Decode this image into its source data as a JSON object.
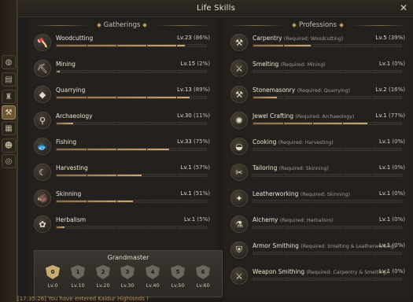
{
  "window": {
    "title": "Life Skills",
    "close_glyph": "✕"
  },
  "left_rail": {
    "icons": [
      {
        "name": "bag-icon",
        "glyph": "◍"
      },
      {
        "name": "book-icon",
        "glyph": "▤"
      },
      {
        "name": "trophy-icon",
        "glyph": "♜"
      },
      {
        "name": "life-skills-icon",
        "glyph": "⚒",
        "active": true
      },
      {
        "name": "cards-icon",
        "glyph": "▦"
      },
      {
        "name": "party-icon",
        "glyph": "☻"
      },
      {
        "name": "globe-icon",
        "glyph": "◎"
      }
    ]
  },
  "gatherings": {
    "header": "Gatherings",
    "skills": [
      {
        "name": "Woodcutting",
        "level": "Lv.23",
        "percent": "(86%)",
        "progress": 0.86,
        "icon": "axe-icon",
        "glyph": "🪓"
      },
      {
        "name": "Mining",
        "level": "Lv.15",
        "percent": "(2%)",
        "progress": 0.02,
        "icon": "pickaxe-icon",
        "glyph": "⛏"
      },
      {
        "name": "Quarrying",
        "level": "Lv.13",
        "percent": "(89%)",
        "progress": 0.89,
        "icon": "stone-icon",
        "glyph": "◆"
      },
      {
        "name": "Archaeology",
        "level": "Lv.30",
        "percent": "(11%)",
        "progress": 0.11,
        "icon": "shovel-icon",
        "glyph": "⚲"
      },
      {
        "name": "Fishing",
        "level": "Lv.33",
        "percent": "(75%)",
        "progress": 0.75,
        "icon": "fish-icon",
        "glyph": "🐟"
      },
      {
        "name": "Harvesting",
        "level": "Lv.1",
        "percent": "(57%)",
        "progress": 0.57,
        "icon": "sickle-icon",
        "glyph": "☾"
      },
      {
        "name": "Skinning",
        "level": "Lv.1",
        "percent": "(51%)",
        "progress": 0.51,
        "icon": "beast-icon",
        "glyph": "🐗"
      },
      {
        "name": "Herbalism",
        "level": "Lv.1",
        "percent": "(5%)",
        "progress": 0.05,
        "icon": "herb-icon",
        "glyph": "✿"
      }
    ]
  },
  "professions": {
    "header": "Professions",
    "skills": [
      {
        "name": "Carpentry",
        "req": "(Required: Woodcutting)",
        "level": "Lv.5",
        "percent": "(39%)",
        "progress": 0.39,
        "icon": "saw-icon",
        "glyph": "⚒"
      },
      {
        "name": "Smelting",
        "req": "(Required: Mining)",
        "level": "Lv.1",
        "percent": "(0%)",
        "progress": 0.0,
        "icon": "tongs-icon",
        "glyph": "⚔"
      },
      {
        "name": "Stonemasonry",
        "req": "(Required: Quarrying)",
        "level": "Lv.2",
        "percent": "(16%)",
        "progress": 0.16,
        "icon": "hammer-icon",
        "glyph": "⚒"
      },
      {
        "name": "Jewel Crafting",
        "req": "(Required: Archaeology)",
        "level": "Lv.1",
        "percent": "(77%)",
        "progress": 0.77,
        "icon": "jewel-icon",
        "glyph": "✺"
      },
      {
        "name": "Cooking",
        "req": "(Required: Harvesting)",
        "level": "Lv.1",
        "percent": "(0%)",
        "progress": 0.0,
        "icon": "pot-icon",
        "glyph": "◒"
      },
      {
        "name": "Tailoring",
        "req": "(Required: Skinning)",
        "level": "Lv.1",
        "percent": "(0%)",
        "progress": 0.0,
        "icon": "needle-icon",
        "glyph": "✂"
      },
      {
        "name": "Leatherworking",
        "req": "(Required: Skinning)",
        "level": "Lv.1",
        "percent": "(0%)",
        "progress": 0.0,
        "icon": "leather-icon",
        "glyph": "✦"
      },
      {
        "name": "Alchemy",
        "req": "(Required: Herbalism)",
        "level": "Lv.1",
        "percent": "(0%)",
        "progress": 0.0,
        "icon": "flask-icon",
        "glyph": "⚗"
      },
      {
        "name": "Armor Smithing",
        "req": "(Required: Smelting & Leatherworking)",
        "level": "Lv.1",
        "percent": "(0%)",
        "progress": 0.0,
        "icon": "armor-icon",
        "glyph": "⛨"
      },
      {
        "name": "Weapon Smithing",
        "req": "(Required: Carpentry & Smelting)",
        "level": "Lv.1",
        "percent": "(0%)",
        "progress": 0.0,
        "icon": "sword-icon",
        "glyph": "⚔"
      }
    ]
  },
  "grandmaster": {
    "title": "Grandmaster",
    "tiers": [
      {
        "num": "0",
        "label": "Lv.0",
        "active": true
      },
      {
        "num": "1",
        "label": "Lv.10",
        "active": false
      },
      {
        "num": "2",
        "label": "Lv.20",
        "active": false
      },
      {
        "num": "3",
        "label": "Lv.30",
        "active": false
      },
      {
        "num": "4",
        "label": "Lv.40",
        "active": false
      },
      {
        "num": "5",
        "label": "Lv.50",
        "active": false
      },
      {
        "num": "6",
        "label": "Lv.60",
        "active": false
      }
    ]
  },
  "chat": {
    "line": "[17:35:26] You have entered Kaldur Highlands !"
  }
}
